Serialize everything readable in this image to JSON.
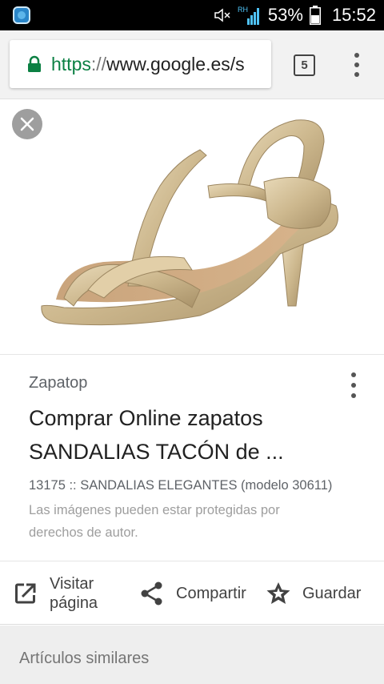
{
  "status_bar": {
    "battery_percent": "53%",
    "time": "15:52",
    "network_label": "RH",
    "icons": [
      "app-icon",
      "mute-icon",
      "signal-icon",
      "battery-icon"
    ]
  },
  "browser": {
    "url_scheme": "https",
    "url_separator": "://",
    "url_host": "www.google.es/s",
    "tab_count": "5",
    "accent_color": "#0b8043"
  },
  "result": {
    "source": "Zapatop",
    "title_line1": "Comprar Online zapatos",
    "title_line2": "SANDALIAS TACÓN de ...",
    "description": "13175 :: SANDALIAS ELEGANTES (modelo 30611)",
    "notice": "Las imágenes pueden estar protegidas por derechos de autor."
  },
  "actions": {
    "visit": "Visitar página",
    "share": "Compartir",
    "save": "Guardar"
  },
  "similar": {
    "title": "Artículos similares"
  }
}
